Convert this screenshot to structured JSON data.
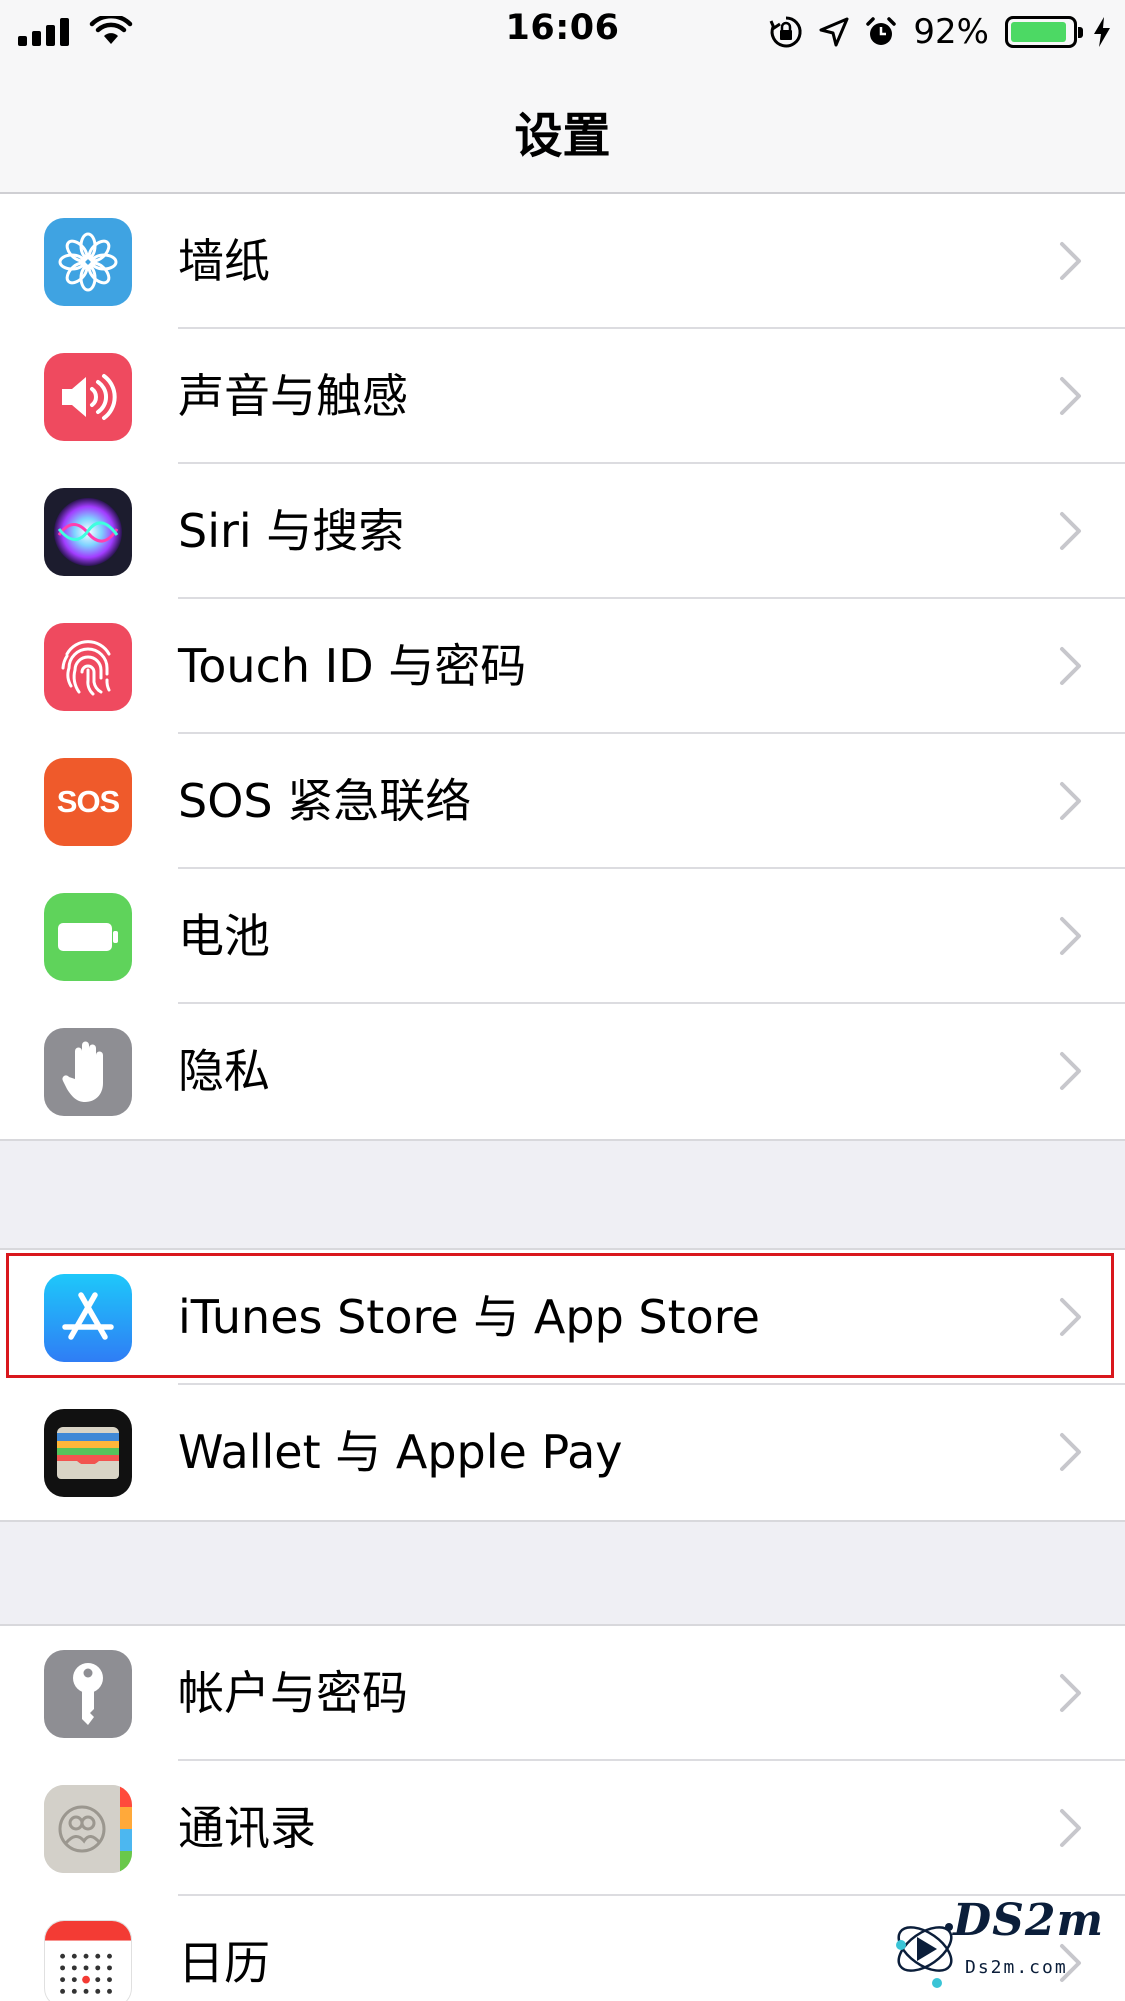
{
  "status_bar": {
    "time": "16:06",
    "battery_percent": "92%",
    "battery_level": 0.92,
    "icons": [
      "signal-icon",
      "wifi-icon",
      "orientation-lock-icon",
      "location-icon",
      "alarm-icon",
      "battery-icon",
      "charging-icon"
    ]
  },
  "nav": {
    "title": "设置"
  },
  "groups": [
    {
      "items": [
        {
          "label": "墙纸",
          "icon": "wallpaper-icon",
          "color": "#3fa3e2"
        },
        {
          "label": "声音与触感",
          "icon": "sound-icon",
          "color": "#ef4a5f"
        },
        {
          "label": "Siri 与搜索",
          "icon": "siri-icon",
          "color": "#1c1c2e"
        },
        {
          "label": "Touch ID 与密码",
          "icon": "touch-id-icon",
          "color": "#ef4a5f"
        },
        {
          "label": "SOS 紧急联络",
          "icon": "sos-icon",
          "color": "#ef5a2b",
          "icon_text": "SOS"
        },
        {
          "label": "电池",
          "icon": "battery-app-icon",
          "color": "#5fd35b"
        },
        {
          "label": "隐私",
          "icon": "privacy-hand-icon",
          "color": "#8e8e93"
        }
      ]
    },
    {
      "items": [
        {
          "label": "iTunes Store 与 App Store",
          "icon": "app-store-icon",
          "color": "#2f8df5"
        },
        {
          "label": "Wallet 与 Apple Pay",
          "icon": "wallet-icon",
          "color": "#111111"
        }
      ]
    },
    {
      "items": [
        {
          "label": "帐户与密码",
          "icon": "key-icon",
          "color": "#8e8e93"
        },
        {
          "label": "通讯录",
          "icon": "contacts-icon",
          "color": "#c9c6c0"
        },
        {
          "label": "日历",
          "icon": "calendar-icon",
          "color": "#ffffff"
        }
      ]
    }
  ],
  "highlight_color": "#d9171d",
  "watermark": {
    "text": "DS2m",
    "subtext": "Ds2m.com"
  }
}
